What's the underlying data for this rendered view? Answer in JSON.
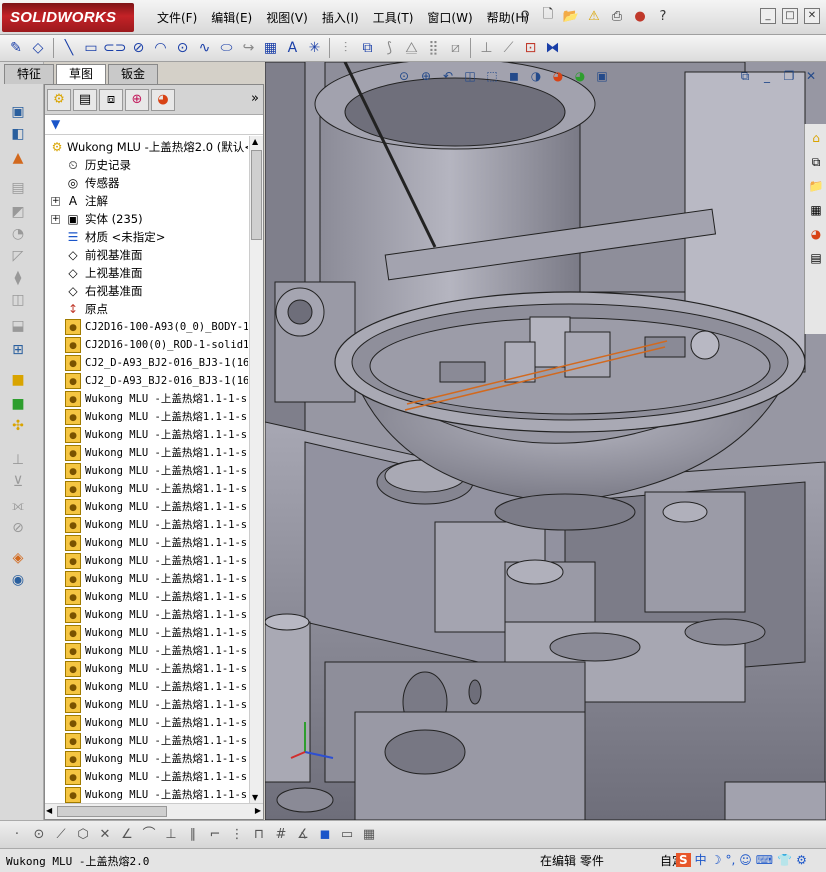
{
  "app": {
    "logo_text": "SOLIDWORKS"
  },
  "menus": [
    "文件(F)",
    "编辑(E)",
    "视图(V)",
    "插入(I)",
    "工具(T)",
    "窗口(W)",
    "帮助(H)"
  ],
  "window_controls": [
    "_",
    "□",
    "✕"
  ],
  "tabs": [
    "特征",
    "草图",
    "钣金"
  ],
  "active_tab": "草图",
  "tree": {
    "root": "Wukong MLU -上盖热熔2.0  (默认<",
    "items": [
      {
        "label": "历史记录",
        "icon": "history-icon"
      },
      {
        "label": "传感器",
        "icon": "sensor-icon"
      },
      {
        "label": "注解",
        "icon": "annotation-icon",
        "expandable": true
      },
      {
        "label": "实体 (235)",
        "icon": "solid-bodies-icon",
        "expandable": true
      },
      {
        "label": "材质 <未指定>",
        "icon": "material-icon"
      },
      {
        "label": "前视基准面",
        "icon": "plane-icon"
      },
      {
        "label": "上视基准面",
        "icon": "plane-icon"
      },
      {
        "label": "右视基准面",
        "icon": "plane-icon"
      },
      {
        "label": "原点",
        "icon": "origin-icon"
      }
    ],
    "parts": [
      "CJ2D16-100-A93(0_0)_BODY-1-s",
      "CJ2D16-100(0)_ROD-1-solid1",
      "CJ2_D-A93_BJ2-016_BJ3-1(16_",
      "CJ2_D-A93_BJ2-016_BJ3-1(16_",
      "Wukong MLU -上盖热熔1.1-1-s",
      "Wukong MLU -上盖热熔1.1-1-s",
      "Wukong MLU -上盖热熔1.1-1-s",
      "Wukong MLU -上盖热熔1.1-1-s",
      "Wukong MLU -上盖热熔1.1-1-s",
      "Wukong MLU -上盖热熔1.1-1-s",
      "Wukong MLU -上盖热熔1.1-1-s",
      "Wukong MLU -上盖热熔1.1-1-s",
      "Wukong MLU -上盖热熔1.1-1-s",
      "Wukong MLU -上盖热熔1.1-1-s",
      "Wukong MLU -上盖热熔1.1-1-s",
      "Wukong MLU -上盖热熔1.1-1-s",
      "Wukong MLU -上盖热熔1.1-1-s",
      "Wukong MLU -上盖热熔1.1-1-s",
      "Wukong MLU -上盖热熔1.1-1-s",
      "Wukong MLU -上盖热熔1.1-1-s",
      "Wukong MLU -上盖热熔1.1-1-s",
      "Wukong MLU -上盖热熔1.1-1-s",
      "Wukong MLU -上盖热熔1.1-1-s",
      "Wukong MLU -上盖热熔1.1-1-s",
      "Wukong MLU -上盖热熔1.1-1-s",
      "Wukong MLU -上盖热熔1.1-1-s",
      "Wukong MLU -上盖热熔1.1-1-s",
      "Wukong MLU -上盖热熔1.1-1-s"
    ]
  },
  "status": {
    "document": "Wukong MLU -上盖热熔2.0",
    "mode": "在编辑 零件",
    "custom": "自定"
  },
  "ime": [
    "S",
    "中",
    "☽",
    "°,",
    "☺",
    "⌨",
    "👕",
    "⚙"
  ],
  "colors": {
    "accent": "#c42227",
    "model": "#9a9aa6",
    "viewport_bg": "#c7c7cf"
  }
}
